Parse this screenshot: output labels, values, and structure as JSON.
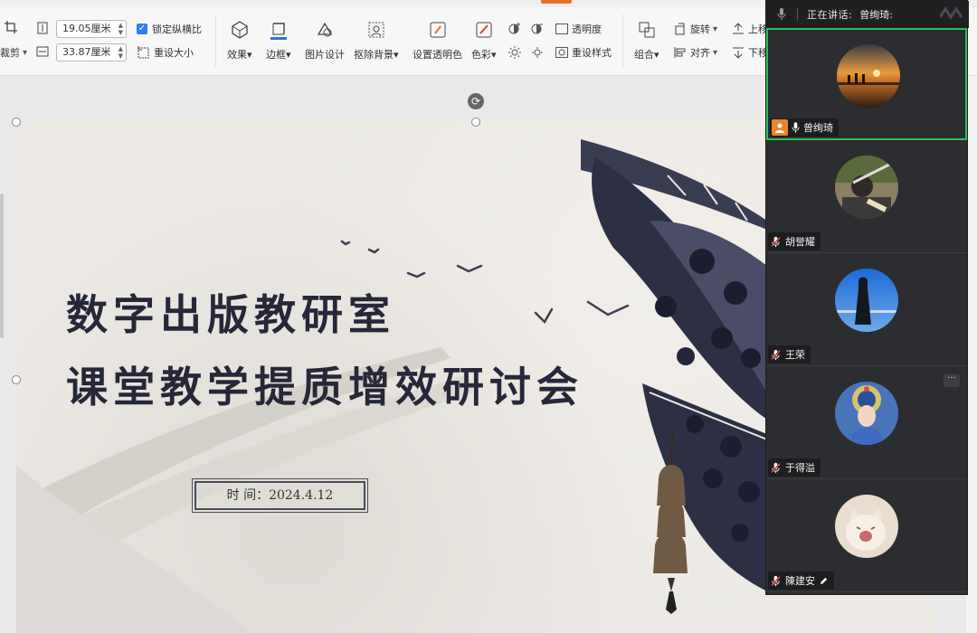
{
  "ribbon": {
    "crop_label": "裁剪",
    "height_value": "19.05厘米",
    "width_value": "33.87厘米",
    "lock_ratio_label": "锁定纵横比",
    "reset_size_label": "重设大小",
    "effects_label": "效果",
    "border_label": "边框",
    "picture_design_label": "图片设计",
    "remove_bg_label": "抠除背景",
    "set_transparent_label": "设置透明色",
    "color_label": "色彩",
    "transparency_label": "透明度",
    "reset_style_label": "重设样式",
    "group_label": "组合",
    "rotate_label": "旋转",
    "align_label": "对齐",
    "up_label": "上移",
    "down_label": "下移"
  },
  "slide": {
    "title_line1": "数字出版教研室",
    "title_line2": "课堂教学提质增效研讨会",
    "date_text": "时  间：2024.4.12"
  },
  "meeting": {
    "speaking_label": "正在讲话:",
    "speaking_name": "曾绚琦:",
    "participants": [
      {
        "name": "曾绚琦",
        "active": true
      },
      {
        "name": "胡誉耀",
        "active": false
      },
      {
        "name": "王荣",
        "active": false
      },
      {
        "name": "于得溢",
        "active": false
      },
      {
        "name": "陳建安",
        "active": false
      }
    ]
  },
  "colors": {
    "active_border": "#2fbf5a",
    "host_badge": "#e8872a",
    "checkbox": "#2e7cf6",
    "title_ink": "#262839"
  }
}
